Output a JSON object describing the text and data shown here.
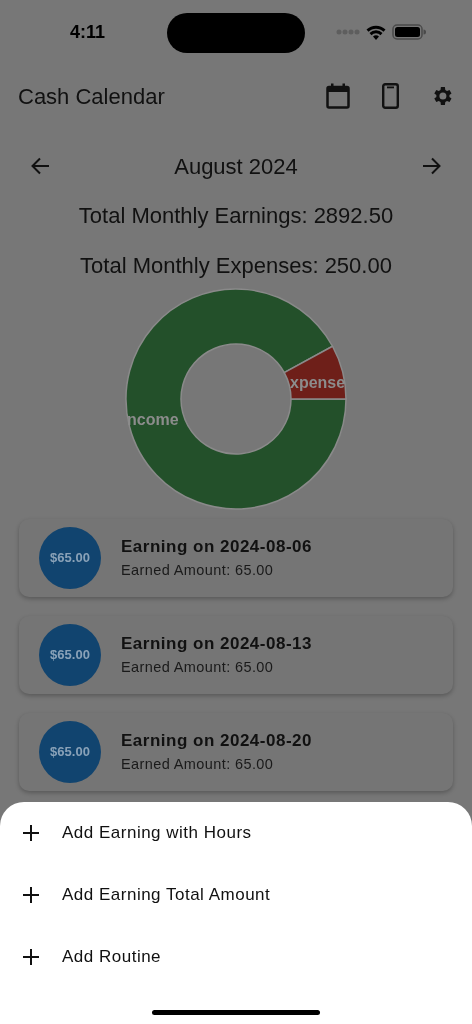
{
  "status_bar": {
    "time": "4:11"
  },
  "app_bar": {
    "title": "Cash Calendar"
  },
  "month_nav": {
    "label": "August 2024"
  },
  "totals": [
    "Total Monthly Earnings: 2892.50",
    "Total Monthly Expenses: 250.00"
  ],
  "donut": {
    "labels": [
      "ncome",
      "xpense"
    ]
  },
  "entries": [
    {
      "badge": "$65.00",
      "title": "Earning on 2024-08-06",
      "subtitle": "Earned Amount: 65.00"
    },
    {
      "badge": "$65.00",
      "title": "Earning on 2024-08-13",
      "subtitle": "Earned Amount: 65.00"
    },
    {
      "badge": "$65.00",
      "title": "Earning on 2024-08-20",
      "subtitle": "Earned Amount: 65.00"
    }
  ],
  "sheet": {
    "items": [
      {
        "label": "Add Earning with Hours"
      },
      {
        "label": "Add Earning Total Amount"
      },
      {
        "label": "Add Routine"
      }
    ]
  }
}
